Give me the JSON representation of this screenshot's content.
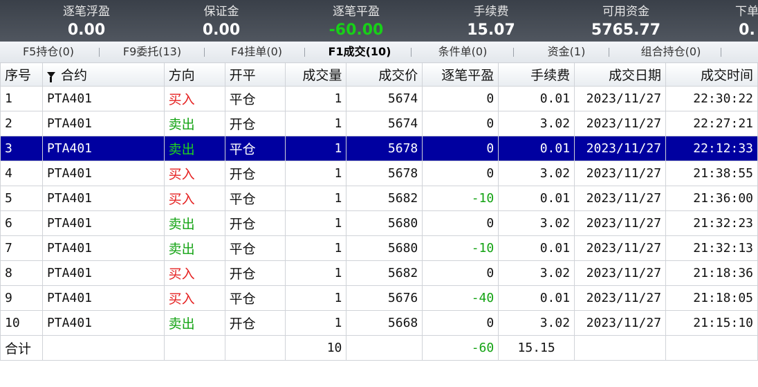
{
  "summary": [
    {
      "label": "逐笔浮盈",
      "value": "0.00",
      "neg": false
    },
    {
      "label": "保证金",
      "value": "0.00",
      "neg": false
    },
    {
      "label": "逐笔平盈",
      "value": "-60.00",
      "neg": true
    },
    {
      "label": "手续费",
      "value": "15.07",
      "neg": false
    },
    {
      "label": "可用资金",
      "value": "5765.77",
      "neg": false
    },
    {
      "label": "下单",
      "value": "0.",
      "neg": false
    }
  ],
  "tabs": [
    {
      "label": "F5持仓(0)",
      "active": false
    },
    {
      "label": "F9委托(13)",
      "active": false
    },
    {
      "label": "F4挂单(0)",
      "active": false
    },
    {
      "label": "F1成交(10)",
      "active": true
    },
    {
      "label": "条件单(0)",
      "active": false
    },
    {
      "label": "资金(1)",
      "active": false
    },
    {
      "label": "组合持仓(0)",
      "active": false
    }
  ],
  "columns": [
    "序号",
    "合约",
    "方向",
    "开平",
    "成交量",
    "成交价",
    "逐笔平盈",
    "手续费",
    "成交日期",
    "成交时间"
  ],
  "rows": [
    {
      "no": "1",
      "contract": "PTA401",
      "dir": "买入",
      "oc": "平仓",
      "qty": "1",
      "price": "5674",
      "pnl": "0",
      "fee": "0.01",
      "date": "2023/11/27",
      "time": "22:30:22",
      "selected": false
    },
    {
      "no": "2",
      "contract": "PTA401",
      "dir": "卖出",
      "oc": "开仓",
      "qty": "1",
      "price": "5674",
      "pnl": "0",
      "fee": "3.02",
      "date": "2023/11/27",
      "time": "22:27:21",
      "selected": false
    },
    {
      "no": "3",
      "contract": "PTA401",
      "dir": "卖出",
      "oc": "平仓",
      "qty": "1",
      "price": "5678",
      "pnl": "0",
      "fee": "0.01",
      "date": "2023/11/27",
      "time": "22:12:33",
      "selected": true
    },
    {
      "no": "4",
      "contract": "PTA401",
      "dir": "买入",
      "oc": "开仓",
      "qty": "1",
      "price": "5678",
      "pnl": "0",
      "fee": "3.02",
      "date": "2023/11/27",
      "time": "21:38:55",
      "selected": false
    },
    {
      "no": "5",
      "contract": "PTA401",
      "dir": "买入",
      "oc": "平仓",
      "qty": "1",
      "price": "5682",
      "pnl": "-10",
      "fee": "0.01",
      "date": "2023/11/27",
      "time": "21:36:00",
      "selected": false
    },
    {
      "no": "6",
      "contract": "PTA401",
      "dir": "卖出",
      "oc": "开仓",
      "qty": "1",
      "price": "5680",
      "pnl": "0",
      "fee": "3.02",
      "date": "2023/11/27",
      "time": "21:32:23",
      "selected": false
    },
    {
      "no": "7",
      "contract": "PTA401",
      "dir": "卖出",
      "oc": "平仓",
      "qty": "1",
      "price": "5680",
      "pnl": "-10",
      "fee": "0.01",
      "date": "2023/11/27",
      "time": "21:32:13",
      "selected": false
    },
    {
      "no": "8",
      "contract": "PTA401",
      "dir": "买入",
      "oc": "开仓",
      "qty": "1",
      "price": "5682",
      "pnl": "0",
      "fee": "3.02",
      "date": "2023/11/27",
      "time": "21:18:36",
      "selected": false
    },
    {
      "no": "9",
      "contract": "PTA401",
      "dir": "买入",
      "oc": "平仓",
      "qty": "1",
      "price": "5676",
      "pnl": "-40",
      "fee": "0.01",
      "date": "2023/11/27",
      "time": "21:18:05",
      "selected": false
    },
    {
      "no": "10",
      "contract": "PTA401",
      "dir": "卖出",
      "oc": "开仓",
      "qty": "1",
      "price": "5668",
      "pnl": "0",
      "fee": "3.02",
      "date": "2023/11/27",
      "time": "21:15:10",
      "selected": false
    }
  ],
  "total": {
    "label": "合计",
    "qty": "10",
    "pnl": "-60",
    "fee": "15.15"
  },
  "colors": {
    "buy": "#e52222",
    "sell": "#13a313",
    "selected_row": "#0000a0"
  },
  "icons": {
    "contract_header": "filter-icon"
  }
}
